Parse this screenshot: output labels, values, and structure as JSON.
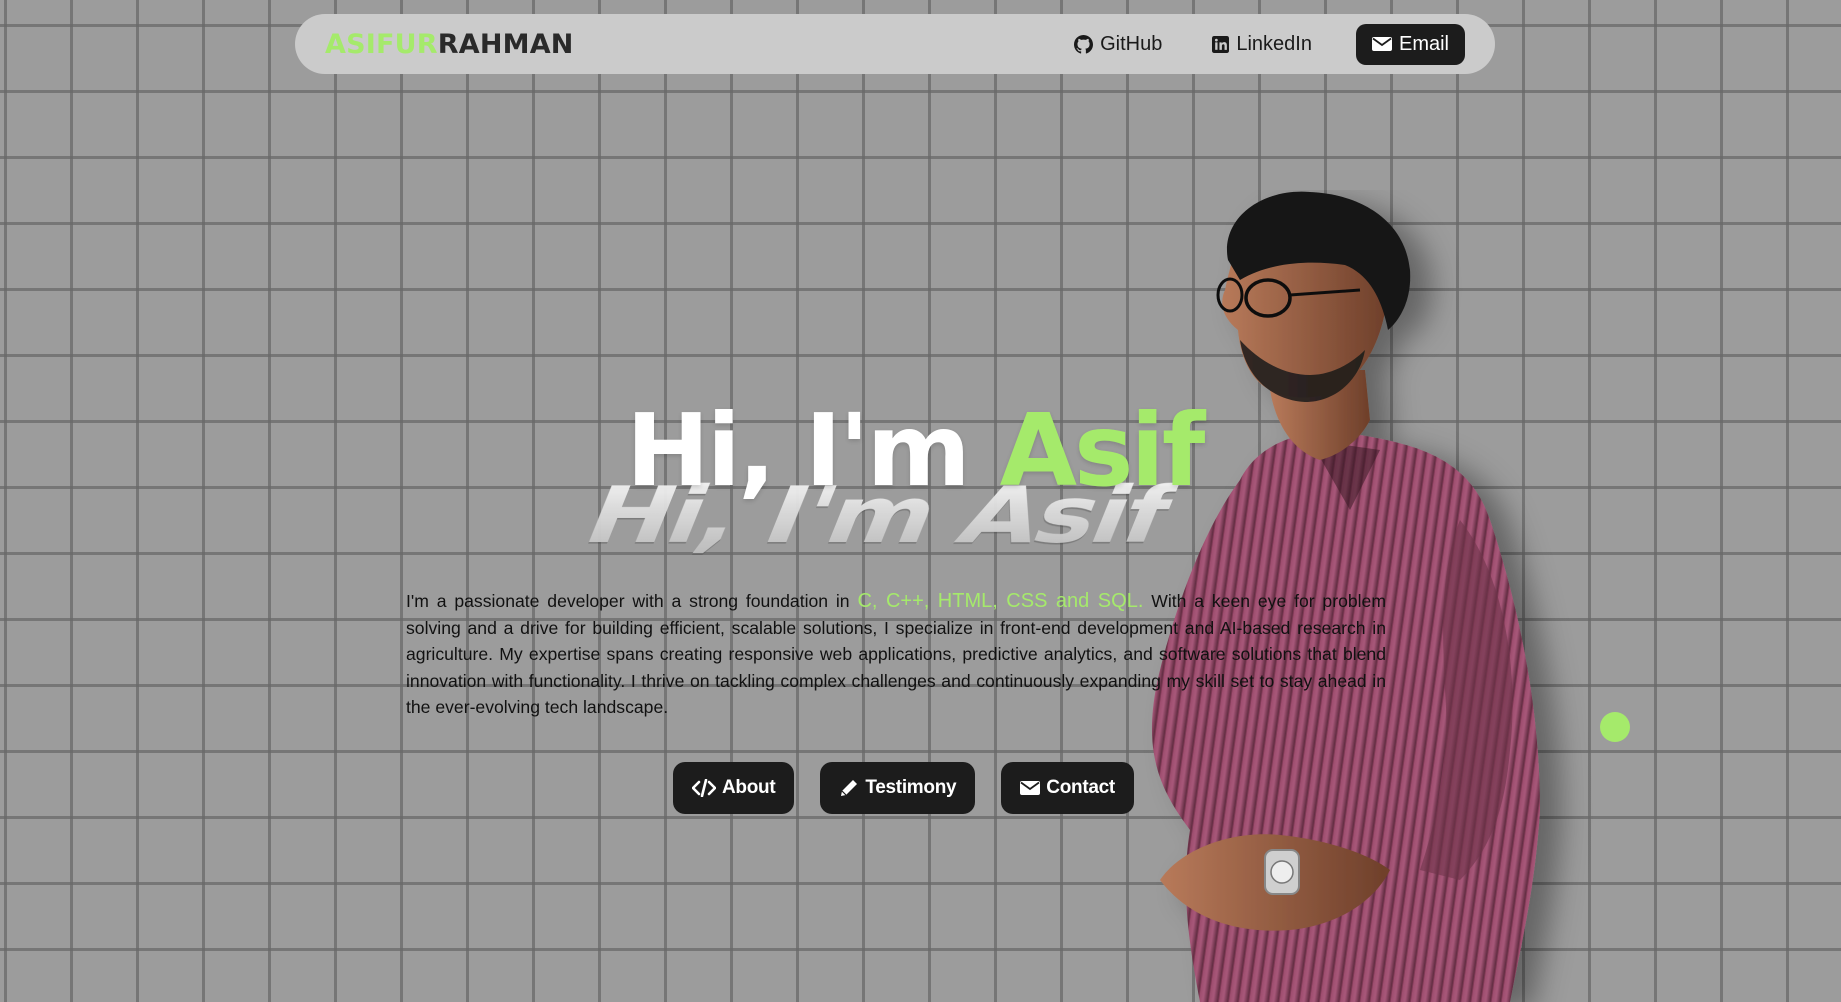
{
  "navbar": {
    "brand_accent": "ASIFUR",
    "brand_main": "RAHMAN",
    "links": [
      {
        "label": "GitHub",
        "icon": "github-icon"
      },
      {
        "label": "LinkedIn",
        "icon": "linkedin-icon"
      },
      {
        "label": "Email",
        "icon": "envelope-icon"
      }
    ]
  },
  "hero": {
    "greeting": "Hi, I'm",
    "name": "Asif"
  },
  "description": {
    "intro": "I'm a passionate developer with a strong foundation in",
    "skills": "C, C++, HTML, CSS and SQL.",
    "rest": "With a keen eye for problem solving and a drive for building efficient, scalable solutions, I specialize in front-end development and AI-based research in agriculture. My expertise spans creating responsive web applications, predictive analytics, and software solutions that blend innovation with functionality. I thrive on tackling complex challenges and continuously expanding my skill set to stay ahead in the ever-evolving tech landscape."
  },
  "actions": [
    {
      "label": "About",
      "icon": "code-icon"
    },
    {
      "label": "Testimony",
      "icon": "pencil-icon"
    },
    {
      "label": "Contact",
      "icon": "envelope-icon"
    }
  ],
  "colors": {
    "accent": "#a5ea6b",
    "background": "#9c9c9c",
    "grid": "#6b6b6b",
    "button": "#1c1c1c",
    "navbar": "#cbcbcb",
    "shirt": "#8a3f5c"
  }
}
